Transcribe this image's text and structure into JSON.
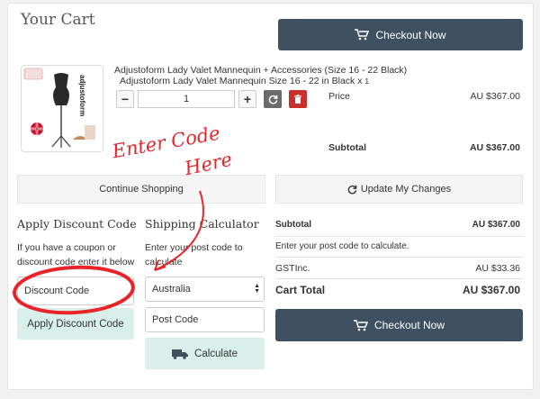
{
  "cart": {
    "title": "Your Cart"
  },
  "checkout": {
    "label": "Checkout Now"
  },
  "product": {
    "name": "Adjustoform Lady Valet Mannequin + Accessories (Size 16 - 22 Black)",
    "subline": "Adjustoform Lady Valet Mannequin Size 16 - 22 in Black x",
    "multiplier": "1",
    "quantity": "1",
    "thumb_brand": "adjustoform",
    "price_label": "Price",
    "price_value": "AU $367.00",
    "subtotal_label": "Subtotal",
    "subtotal_value": "AU $367.00"
  },
  "actions": {
    "continue": "Continue Shopping",
    "update": "Update My Changes"
  },
  "discount": {
    "heading": "Apply Discount Code",
    "help": [
      "If you have a coupon or",
      "discount code enter it below"
    ],
    "placeholder": "Discount Code",
    "button": "Apply Discount Code"
  },
  "shipping": {
    "heading": "Shipping Calculator",
    "help": [
      "Enter your post code to",
      "calculate"
    ],
    "country": "Australia",
    "postcode_placeholder": "Post Code",
    "button": "Calculate"
  },
  "summary": {
    "subtotal_label": "Subtotal",
    "subtotal_value": "AU $367.00",
    "postcode_note": "Enter your post code to calculate.",
    "tax_label": "GSTInc.",
    "tax_value": "AU $33.36",
    "total_label": "Cart Total",
    "total_value": "AU $367.00"
  },
  "annotation": {
    "line1": "Enter Code",
    "line2": "Here"
  },
  "colors": {
    "dark_button": "#3f5161",
    "teal_button": "#d9efe9",
    "delete_red": "#c9302c",
    "annotation_red": "#e8242a"
  }
}
